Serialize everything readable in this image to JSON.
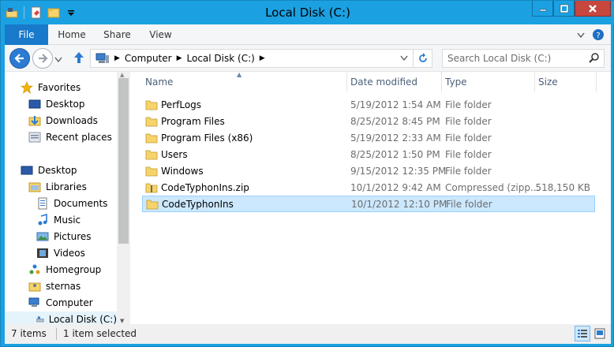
{
  "window": {
    "title": "Local Disk (C:)"
  },
  "ribbon": {
    "tabs": [
      "File",
      "Home",
      "Share",
      "View"
    ]
  },
  "address": {
    "crumbs": [
      "Computer",
      "Local Disk (C:)"
    ]
  },
  "search": {
    "placeholder": "Search Local Disk (C:)"
  },
  "navpane": {
    "items": [
      {
        "label": "Favorites",
        "icon": "star-icon"
      },
      {
        "label": "Desktop",
        "icon": "desktop-icon"
      },
      {
        "label": "Downloads",
        "icon": "downloads-icon"
      },
      {
        "label": "Recent places",
        "icon": "recent-places-icon"
      },
      {
        "label": "Desktop",
        "icon": "desktop-icon"
      },
      {
        "label": "Libraries",
        "icon": "libraries-icon"
      },
      {
        "label": "Documents",
        "icon": "documents-icon"
      },
      {
        "label": "Music",
        "icon": "music-icon"
      },
      {
        "label": "Pictures",
        "icon": "pictures-icon"
      },
      {
        "label": "Videos",
        "icon": "videos-icon"
      },
      {
        "label": "Homegroup",
        "icon": "homegroup-icon"
      },
      {
        "label": "sternas",
        "icon": "user-folder-icon"
      },
      {
        "label": "Computer",
        "icon": "computer-icon"
      },
      {
        "label": "Local Disk (C:)",
        "icon": "drive-icon"
      }
    ]
  },
  "filelist": {
    "columns": [
      "Name",
      "Date modified",
      "Type",
      "Size"
    ],
    "rows": [
      {
        "name": "PerfLogs",
        "date": "5/19/2012 1:54 AM",
        "type": "File folder",
        "size": "",
        "icon": "folder-icon"
      },
      {
        "name": "Program Files",
        "date": "8/25/2012 8:45 PM",
        "type": "File folder",
        "size": "",
        "icon": "folder-icon"
      },
      {
        "name": "Program Files (x86)",
        "date": "5/19/2012 2:33 AM",
        "type": "File folder",
        "size": "",
        "icon": "folder-icon"
      },
      {
        "name": "Users",
        "date": "8/25/2012 1:50 PM",
        "type": "File folder",
        "size": "",
        "icon": "folder-icon"
      },
      {
        "name": "Windows",
        "date": "9/15/2012 12:35 PM",
        "type": "File folder",
        "size": "",
        "icon": "folder-icon"
      },
      {
        "name": "CodeTyphonIns.zip",
        "date": "10/1/2012 9:42 AM",
        "type": "Compressed (zipp...",
        "size": "518,150 KB",
        "icon": "zip-icon"
      },
      {
        "name": "CodeTyphonIns",
        "date": "10/1/2012 12:10 PM",
        "type": "File folder",
        "size": "",
        "icon": "folder-icon"
      }
    ]
  },
  "status": {
    "count": "7 items",
    "selected": "1 item selected"
  },
  "colors": {
    "accent": "#1ba1e2",
    "file_tab": "#1979ca",
    "selection": "#cce8ff",
    "close_button": "#c7463d"
  }
}
